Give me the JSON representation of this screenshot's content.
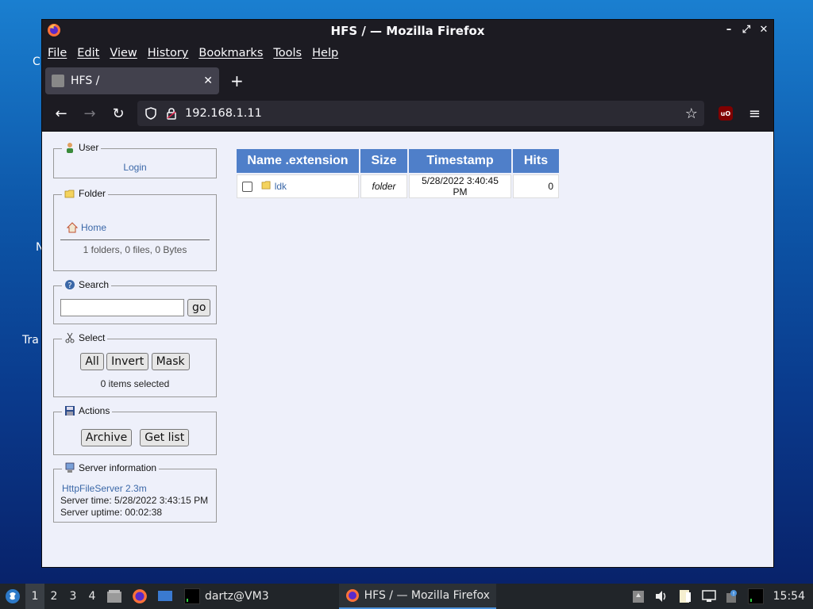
{
  "desktop": {
    "fragments": [
      "C",
      "N",
      "Tra"
    ]
  },
  "window": {
    "title": "HFS / — Mozilla Firefox",
    "controls": [
      "–",
      "⤢",
      "✕"
    ]
  },
  "menu": [
    "File",
    "Edit",
    "View",
    "History",
    "Bookmarks",
    "Tools",
    "Help"
  ],
  "tab": {
    "title": "HFS /",
    "close": "✕",
    "new_tab": "+"
  },
  "nav": {
    "back": "←",
    "forward": "→",
    "reload": "↻",
    "url": "192.168.1.11",
    "ublock_label": "uO",
    "menu": "≡"
  },
  "sidebar": {
    "user": {
      "legend": "User",
      "login": "Login"
    },
    "folder": {
      "legend": "Folder",
      "home": "Home",
      "summary": "1 folders, 0 files, 0 Bytes"
    },
    "search": {
      "legend": "Search",
      "value": "",
      "go": "go"
    },
    "select": {
      "legend": "Select",
      "all": "All",
      "invert": "Invert",
      "mask": "Mask",
      "status": "0 items selected"
    },
    "actions": {
      "legend": "Actions",
      "archive": "Archive",
      "get_list": "Get list"
    },
    "server": {
      "legend": "Server information",
      "version": "HttpFileServer 2.3m",
      "time": "Server time: 5/28/2022 3:43:15 PM",
      "uptime": "Server uptime: 00:02:38"
    }
  },
  "files": {
    "headers": [
      "Name .extension",
      "Size",
      "Timestamp",
      "Hits"
    ],
    "rows": [
      {
        "name": "ldk",
        "size": "folder",
        "timestamp": "5/28/2022 3:40:45 PM",
        "hits": "0"
      }
    ]
  },
  "taskbar": {
    "workspaces": [
      "1",
      "2",
      "3",
      "4"
    ],
    "terminal_task": "dartz@VM3",
    "firefox_task": "HFS / — Mozilla Firefox",
    "clock": "15:54"
  },
  "colors": {
    "header_blue": "#4f7fc9",
    "link_blue": "#3b68a8",
    "page_bg": "#eef0fa"
  }
}
